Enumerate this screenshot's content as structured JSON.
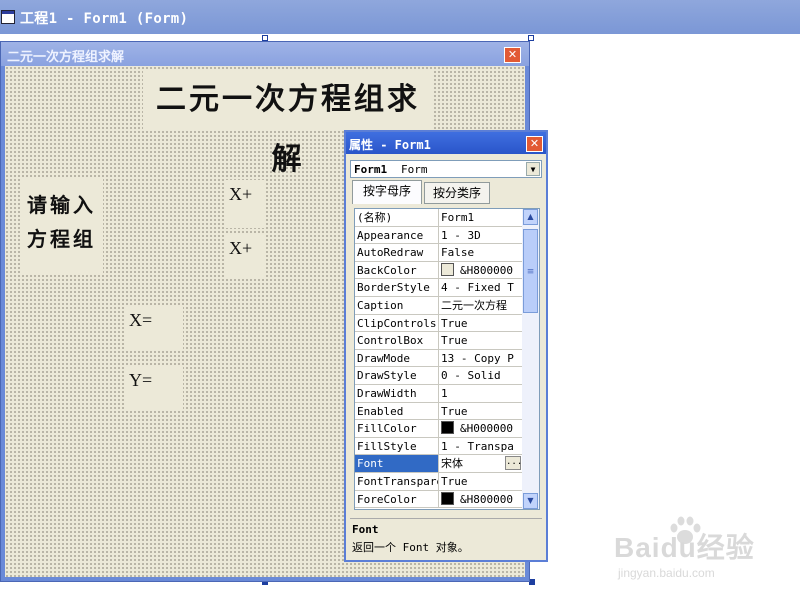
{
  "ide": {
    "title": "工程1 - Form1 (Form)"
  },
  "form": {
    "caption": "二元一次方程组求解",
    "labels": {
      "heading": "二元一次方程组求解",
      "prompt_line1": "请输入",
      "prompt_line2": "方程组",
      "x_plus_1": "X+",
      "x_plus_2": "X+",
      "x_eq": "X=",
      "y_eq": "Y="
    }
  },
  "properties": {
    "title": "属性 - Form1",
    "object_name": "Form1",
    "object_type": "Form",
    "tabs": [
      "按字母序",
      "按分类序"
    ],
    "rows": [
      {
        "name": "(名称)",
        "value": "Form1"
      },
      {
        "name": "Appearance",
        "value": "1 - 3D"
      },
      {
        "name": "AutoRedraw",
        "value": "False"
      },
      {
        "name": "BackColor",
        "value": "&H800000",
        "swatch": "#ece9d8"
      },
      {
        "name": "BorderStyle",
        "value": "4 - Fixed T"
      },
      {
        "name": "Caption",
        "value": "二元一次方程"
      },
      {
        "name": "ClipControls",
        "value": "True"
      },
      {
        "name": "ControlBox",
        "value": "True"
      },
      {
        "name": "DrawMode",
        "value": "13 - Copy P"
      },
      {
        "name": "DrawStyle",
        "value": "0 - Solid"
      },
      {
        "name": "DrawWidth",
        "value": "1"
      },
      {
        "name": "Enabled",
        "value": "True"
      },
      {
        "name": "FillColor",
        "value": "&H000000",
        "swatch": "#000000"
      },
      {
        "name": "FillStyle",
        "value": "1 - Transpa"
      },
      {
        "name": "Font",
        "value": "宋体",
        "selected": true
      },
      {
        "name": "FontTransparent",
        "value": "True"
      },
      {
        "name": "ForeColor",
        "value": "&H800000",
        "swatch": "#000000"
      }
    ],
    "description_title": "Font",
    "description_text": "返回一个 Font 对象。"
  },
  "watermark": {
    "brand": "Baidu经验",
    "site": "jingyan.baidu.com"
  },
  "colors": {
    "ide_title": "#7b97d6",
    "form_bg": "#ece9d8",
    "props_title": "#2a55c9",
    "close": "#e25a34",
    "selection": "#316ac5"
  },
  "icons": {
    "close": "close-icon",
    "dropdown": "chevron-down-icon",
    "scroll_up": "scroll-up-icon",
    "scroll_down": "scroll-down-icon",
    "ellipsis": "ellipsis-button"
  }
}
